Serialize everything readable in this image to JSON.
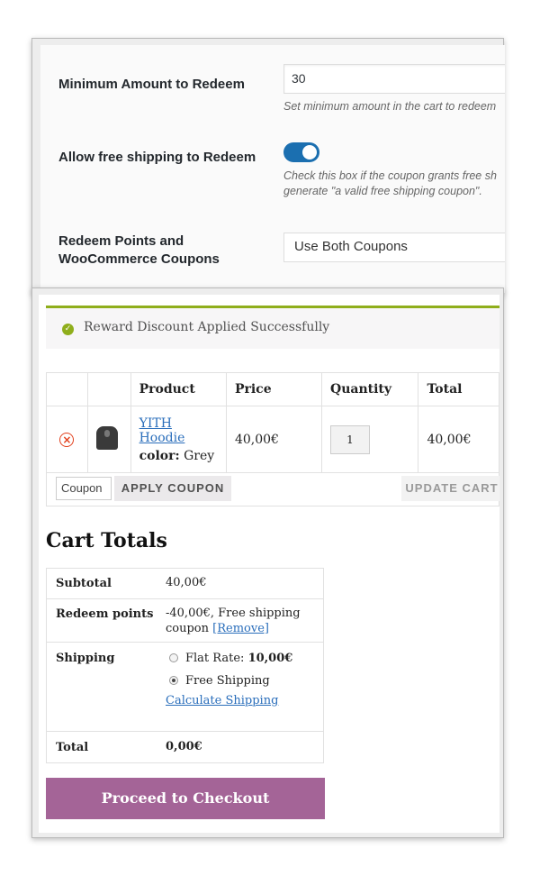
{
  "settings": {
    "min_amount": {
      "label": "Minimum Amount to Redeem",
      "value": "30",
      "description": "Set minimum amount in the cart to redeem"
    },
    "free_shipping": {
      "label": "Allow free shipping to Redeem",
      "enabled": true,
      "description_line1": "Check this box if the coupon grants free sh",
      "description_line2": "generate \"a valid free shipping coupon\"."
    },
    "redeem_coupons": {
      "label_line1": "Redeem Points and",
      "label_line2": "WooCommerce Coupons",
      "selected": "Use Both Coupons"
    }
  },
  "cart": {
    "notice": "Reward Discount Applied Successfully",
    "notice_icon": "check-icon",
    "headers": [
      "Product",
      "Price",
      "Quantity",
      "Total"
    ],
    "item": {
      "name": "YITH Hoodie",
      "attr_label": "color:",
      "attr_value": "Grey",
      "price": "40,00€",
      "quantity": "1",
      "total": "40,00€"
    },
    "coupon_placeholder": "Coupon",
    "apply_coupon": "APPLY COUPON",
    "update_cart": "UPDATE CART"
  },
  "totals": {
    "title": "Cart Totals",
    "subtotal_label": "Subtotal",
    "subtotal_value": "40,00€",
    "redeem_label": "Redeem points",
    "redeem_value_line1": "-40,00€, Free shipping",
    "redeem_value_line2": "coupon",
    "remove_link": "[Remove]",
    "shipping_label": "Shipping",
    "flat_rate_label": "Flat Rate:",
    "flat_rate_value": "10,00€",
    "free_shipping": "Free Shipping",
    "calculate_shipping": "Calculate Shipping",
    "total_label": "Total",
    "total_value": "0,00€",
    "checkout": "Proceed to Checkout"
  },
  "colors": {
    "toggle_on": "#1b6fb0",
    "notice_accent": "#8fae1b",
    "checkout_button": "#a46497",
    "link": "#2a6ebb",
    "remove": "#e2401c"
  }
}
